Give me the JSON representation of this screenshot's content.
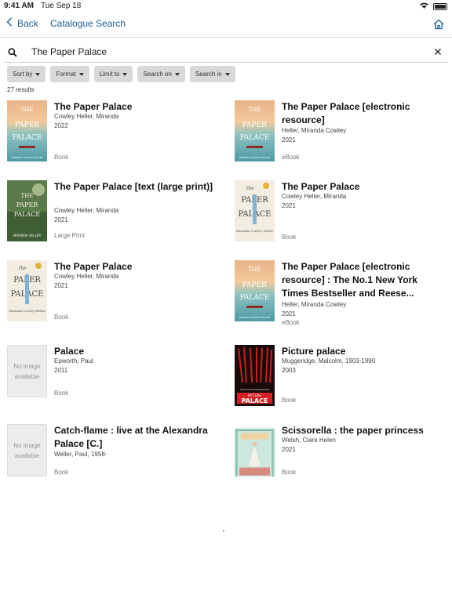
{
  "status": {
    "time": "9:41 AM",
    "date": "Tue Sep 18"
  },
  "nav": {
    "back_label": "Back",
    "title": "Catalogue Search"
  },
  "search": {
    "value": "The Paper Palace"
  },
  "filters": [
    "Sort by",
    "Format",
    "Limit to",
    "Search on",
    "Search in"
  ],
  "results_count": "27 results",
  "no_image_text": "No image available",
  "results": [
    {
      "title": "The Paper Palace",
      "author": "Cowley Heller, Miranda",
      "year": "2022",
      "type": "Book",
      "cover": "paper-palace-sunset"
    },
    {
      "title": "The Paper Palace [electronic resource]",
      "author": "Heller, Miranda Cowley",
      "year": "2021",
      "type": "eBook",
      "cover": "paper-palace-sunset"
    },
    {
      "title": "The Paper Palace [text (large print)]",
      "author": "Cowley Heller, Miranda",
      "year": "2021",
      "type": "Large Print",
      "cover": "paper-palace-green"
    },
    {
      "title": "The Paper Palace",
      "author": "Cowley Heller, Miranda",
      "year": "2021",
      "type": "Book",
      "cover": "paper-palace-cream"
    },
    {
      "title": "The Paper Palace",
      "author": "Cowley Heller, Miranda",
      "year": "2021",
      "type": "Book",
      "cover": "paper-palace-cream"
    },
    {
      "title": "The Paper Palace [electronic resource] : The No.1 New York Times Bestseller and Reese...",
      "author": "Heller, Miranda Cowley",
      "year": "2021",
      "type": "eBook",
      "cover": "paper-palace-sunset"
    },
    {
      "title": "Palace",
      "author": "Epworth, Paul",
      "year": "2011",
      "type": "Book",
      "cover": "none"
    },
    {
      "title": "Picture palace",
      "author": "Muggeridge, Malcolm, 1903-1990",
      "year": "2003",
      "type": "Book",
      "cover": "picture-palace"
    },
    {
      "title": "Catch-flame : live at the Alexandra Palace [C.]",
      "author": "Weller, Paul, 1958-",
      "year": "",
      "type": "Book",
      "cover": "none"
    },
    {
      "title": "Scissorella : the paper princess",
      "author": "Welsh, Clare Helen",
      "year": "2021",
      "type": "Book",
      "cover": "scissorella"
    }
  ]
}
